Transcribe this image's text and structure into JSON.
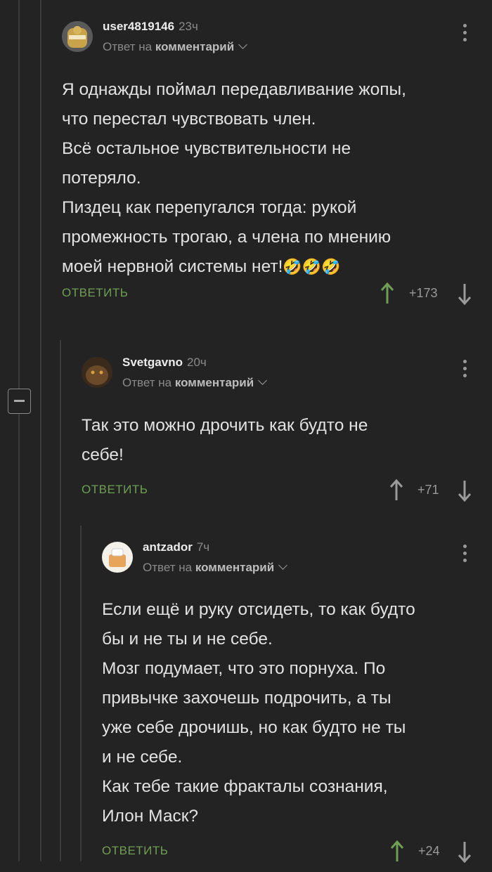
{
  "reply_label": "ОТВЕТИТЬ",
  "reply_to_prefix": "Ответ на",
  "reply_to_target": "комментарий",
  "comments": [
    {
      "author": "user4819146",
      "time": "23ч",
      "text": "Я однажды поймал передавливание жопы,\nчто перестал чувствовать член.\nВсё остальное чувствительности не\nпотеряло.\nПиздец как перепугался тогда: рукой\nпромежность трогаю, а члена по мнению\nмоей нервной системы нет!",
      "emoji": "🤣🤣🤣",
      "rating": "+173",
      "upvoted": true
    },
    {
      "author": "Svetgavno",
      "time": "20ч",
      "text": "Так это можно дрочить как будто не\nсебе!",
      "rating": "+71",
      "upvoted": false
    },
    {
      "author": "antzador",
      "time": "7ч",
      "text": "Если ещё и руку отсидеть, то как будто\nбы и не ты и не себе.\nМозг подумает, что это порнуха. По\nпривычке захочешь подрочить, а ты\nуже себе дрочишь, но как будто не ты\nи не себе.\nКак тебе такие фракталы сознания,\nИлон Маск?",
      "rating": "+24",
      "upvoted": true
    }
  ],
  "colors": {
    "background": "#232323",
    "accent": "#6f9e54",
    "muted": "#8a8a8a"
  }
}
